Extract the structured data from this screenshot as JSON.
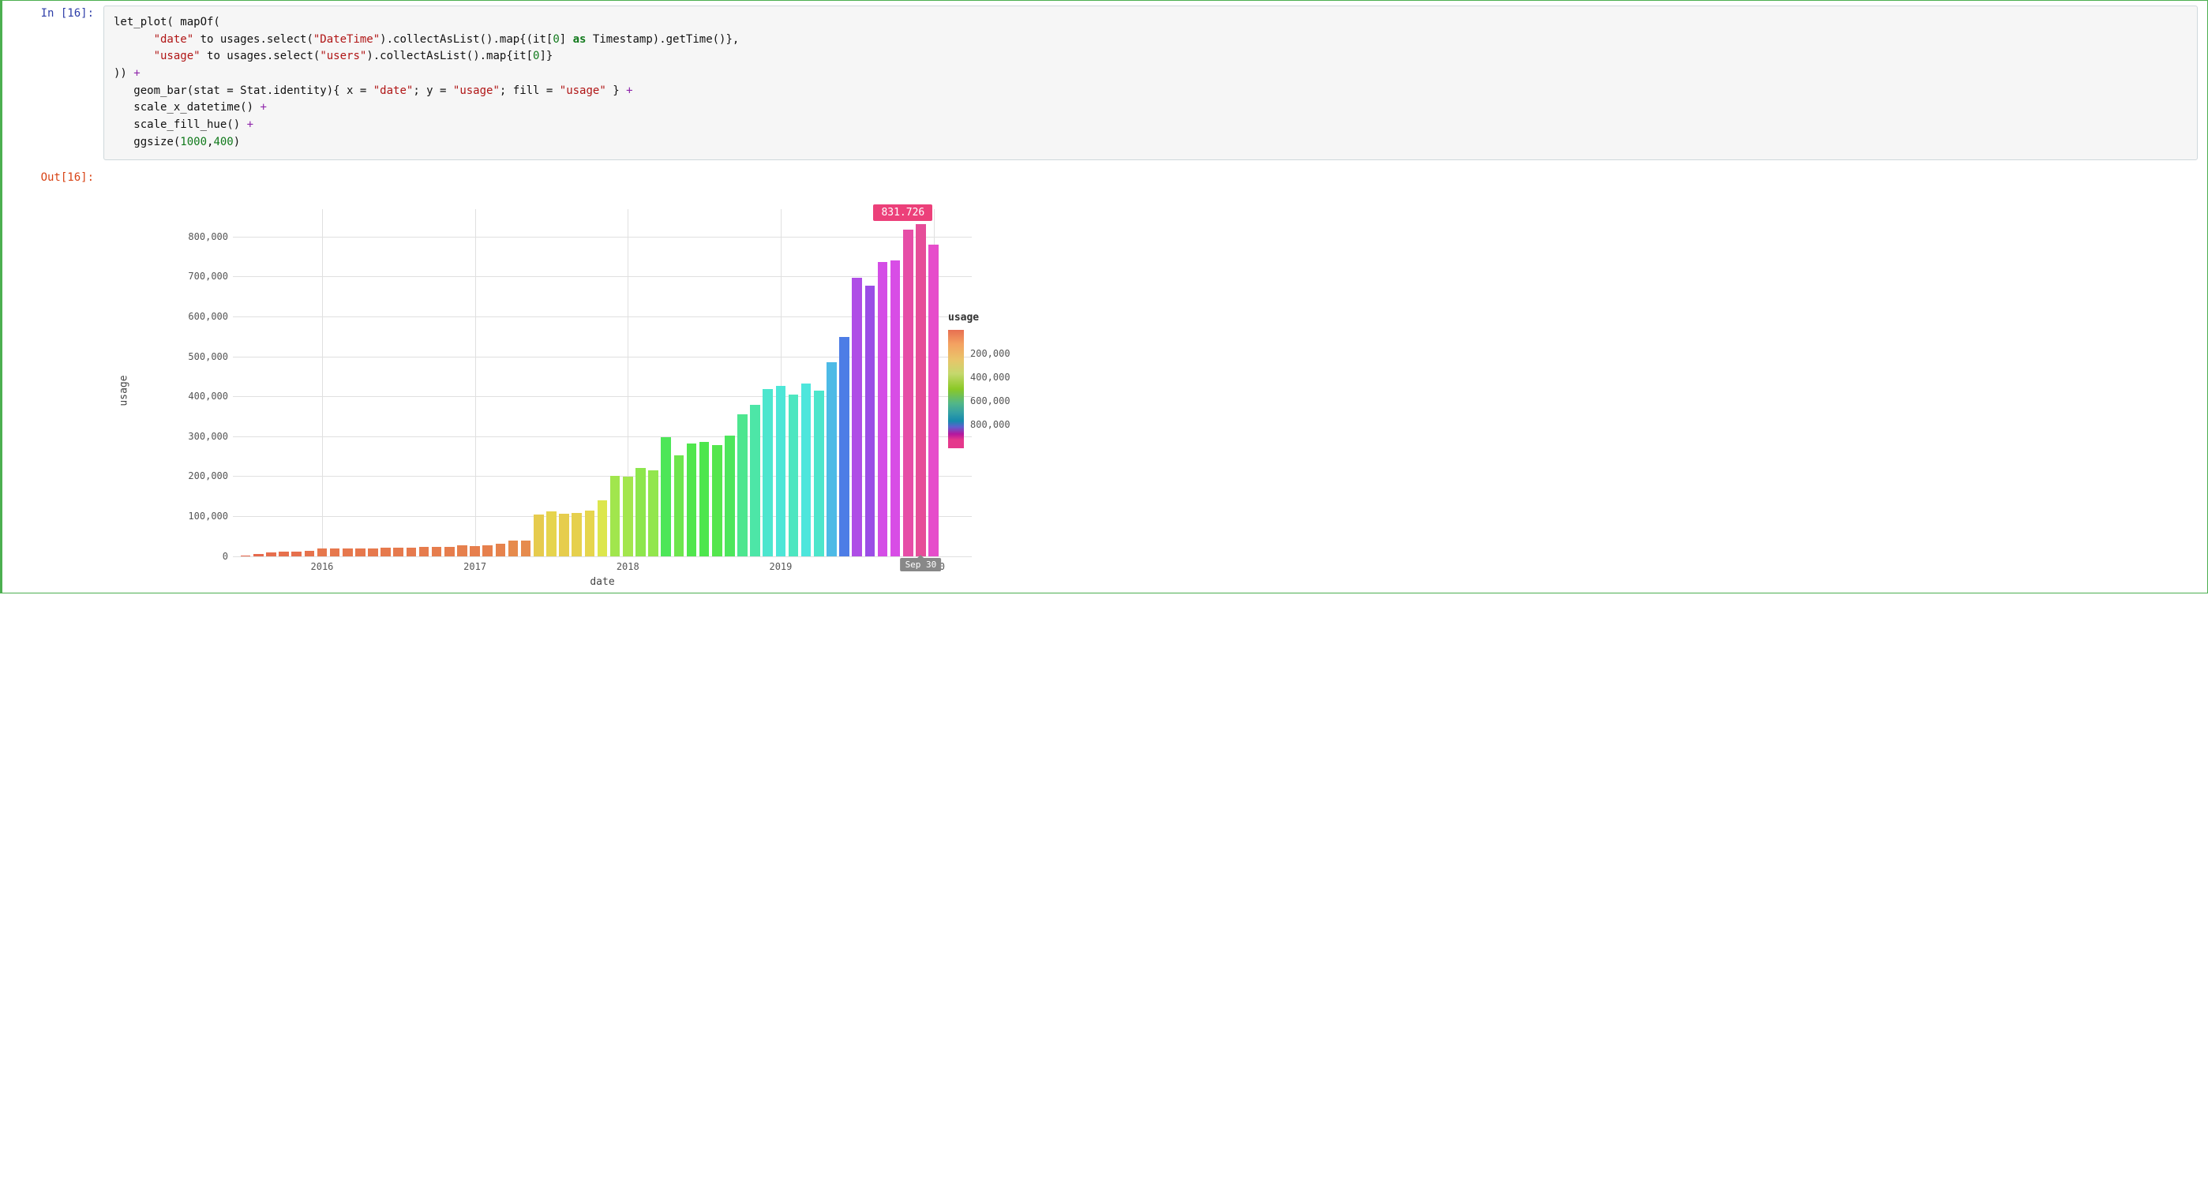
{
  "cell": {
    "in_prompt": "In [16]:",
    "out_prompt": "Out[16]:",
    "code": {
      "line1_a": "let_plot( mapOf(",
      "line2_key": "\"date\"",
      "line2_mid": " to usages.select(",
      "line2_arg": "\"DateTime\"",
      "line2_end1": ").collectAsList().map{(it[",
      "line2_zero": "0",
      "line2_end2": "] ",
      "line2_as": "as",
      "line2_end3": " Timestamp).getTime()},",
      "line3_key": "\"usage\"",
      "line3_mid": " to usages.select(",
      "line3_arg": "\"users\"",
      "line3_end1": ").collectAsList().map{it[",
      "line3_zero": "0",
      "line3_end2": "]}",
      "line4": ")) ",
      "plus": "+",
      "line5_a": "   geom_bar(stat = Stat.identity){ x = ",
      "line5_x": "\"date\"",
      "line5_b": "; y = ",
      "line5_y": "\"usage\"",
      "line5_c": "; fill = ",
      "line5_f": "\"usage\"",
      "line5_d": " } ",
      "line6": "   scale_x_datetime() ",
      "line7": "   scale_fill_hue() ",
      "line8_a": "   ggsize(",
      "line8_n1": "1000",
      "line8_comma": ",",
      "line8_n2": "400",
      "line8_b": ")"
    }
  },
  "chart_data": {
    "type": "bar",
    "xlabel": "date",
    "ylabel": "usage",
    "ylim": [
      0,
      870000
    ],
    "y_ticks": [
      0,
      100000,
      200000,
      300000,
      400000,
      500000,
      600000,
      700000,
      800000
    ],
    "y_tick_labels": [
      "0",
      "100,000",
      "200,000",
      "300,000",
      "400,000",
      "500,000",
      "600,000",
      "700,000",
      "800,000"
    ],
    "x_ticks": [
      "2016",
      "2017",
      "2018",
      "2019",
      "2020"
    ],
    "tooltip_value": "831.726",
    "tooltip_date": "Sep 30",
    "legend": {
      "title": "usage",
      "ticks": [
        "200,000",
        "400,000",
        "600,000",
        "800,000"
      ]
    },
    "categories": [
      "2015-07",
      "2015-08",
      "2015-09",
      "2015-10",
      "2015-11",
      "2015-12",
      "2016-01",
      "2016-02",
      "2016-03",
      "2016-04",
      "2016-05",
      "2016-06",
      "2016-07",
      "2016-08",
      "2016-09",
      "2016-10",
      "2016-11",
      "2016-12",
      "2017-01",
      "2017-02",
      "2017-03",
      "2017-04",
      "2017-05",
      "2017-06",
      "2017-07",
      "2017-08",
      "2017-09",
      "2017-10",
      "2017-11",
      "2017-12",
      "2018-01",
      "2018-02",
      "2018-03",
      "2018-04",
      "2018-05",
      "2018-06",
      "2018-07",
      "2018-08",
      "2018-09",
      "2018-10",
      "2018-11",
      "2018-12",
      "2019-01",
      "2019-02",
      "2019-03",
      "2019-04",
      "2019-05",
      "2019-06",
      "2019-07",
      "2019-08",
      "2019-09",
      "2019-10",
      "2019-11"
    ],
    "values": [
      2000,
      4000,
      8000,
      10000,
      10000,
      13000,
      18000,
      18000,
      18000,
      18000,
      19000,
      20000,
      20000,
      20000,
      22000,
      23000,
      23000,
      27000,
      25000,
      27000,
      30000,
      38000,
      38000,
      103000,
      112000,
      105000,
      108000,
      113000,
      140000,
      200000,
      198000,
      220000,
      215000,
      298000,
      253000,
      282000,
      285000,
      278000,
      302000,
      354000,
      378000,
      418000,
      427000,
      404000,
      432000,
      415000,
      486000,
      549000,
      698000,
      678000,
      736000,
      740000,
      818000
    ],
    "extra_bars": [
      {
        "cat": "2019-12",
        "value": 832000
      },
      {
        "cat": "2020-01",
        "value": 781000
      }
    ]
  }
}
